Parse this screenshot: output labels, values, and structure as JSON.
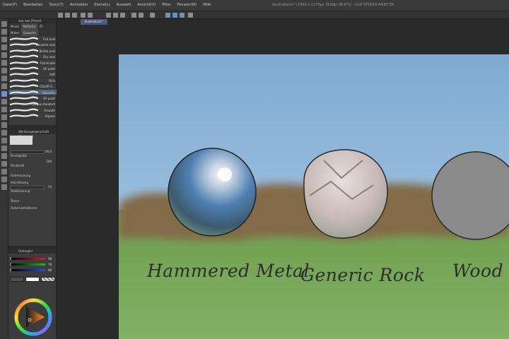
{
  "window": {
    "title": "Illustration1* (1560 x 1170px 350dpi 96.6%) - CLIP STUDIO PAINT EX"
  },
  "menu": {
    "items": [
      "Datei(F)",
      "Bearbeiten",
      "Story(T)",
      "Animation",
      "Ebene(L)",
      "Auswahl",
      "Ansicht(V)",
      "Filter",
      "Fenster(W)",
      "Hilfe"
    ]
  },
  "canvas_tab": {
    "label": "Illustration1*"
  },
  "subtool_panel": {
    "header": "Sub tool [Pinsel]",
    "tabs": [
      "Pinsel",
      "Malfarbe",
      "Öl"
    ],
    "group_tabs": [
      "Malen",
      "Gouache"
    ],
    "brushes": [
      {
        "label": "Flat oval"
      },
      {
        "label": "Gouache oval"
      },
      {
        "label": "Bristle oval"
      },
      {
        "label": "Dry oval"
      },
      {
        "label": "Flat bristle"
      },
      {
        "label": "Oil paint"
      },
      {
        "label": "Soft"
      },
      {
        "label": "Rich"
      },
      {
        "label": "COLOR Fi..."
      },
      {
        "label": "Gouache"
      },
      {
        "label": "Oil paint"
      },
      {
        "label": "Opaque standard"
      },
      {
        "label": "Smooth"
      },
      {
        "label": "Square"
      }
    ],
    "selected_index": 9
  },
  "tool_property": {
    "header": "Werkzeugeigenschaft [Gouache]",
    "rows": [
      {
        "label": "Pinselgröße",
        "value": "40.0"
      },
      {
        "label": "Deckkraft",
        "value": "100"
      },
      {
        "label": "Farbmischung",
        "value": ""
      },
      {
        "label": "Anti-Aliasing",
        "value": ""
      },
      {
        "label": "Stabilisierung",
        "value": "13"
      },
      {
        "label": "Textur",
        "value": ""
      },
      {
        "label": "Farbe kontrollieren",
        "value": ""
      }
    ]
  },
  "color_panel": {
    "header": "Farbregler",
    "sliders": [
      {
        "channel": "R",
        "value": "98"
      },
      {
        "channel": "G",
        "value": "78"
      },
      {
        "channel": "B",
        "value": "68"
      }
    ],
    "main_color": "#5a4a44",
    "sub_color": "#ffffff"
  },
  "captions": {
    "left": "Hammered Metal",
    "middle": "Generic Rock",
    "right": "Wood"
  },
  "colors": {
    "sky": "#8fb8d9",
    "ground": "#79a85a",
    "selected_tool": "#6e8fc9"
  }
}
